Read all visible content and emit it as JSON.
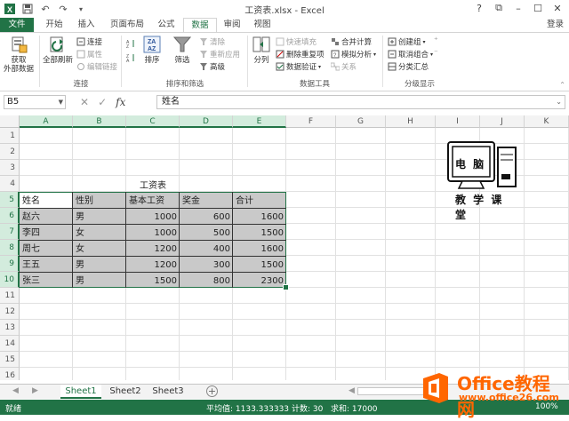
{
  "window": {
    "title": "工资表.xlsx - Excel",
    "controls": [
      "?",
      "⧉",
      "–",
      "☐",
      "✕"
    ]
  },
  "ribbon": {
    "tabs": [
      "文件",
      "开始",
      "插入",
      "页面布局",
      "公式",
      "数据",
      "审阅",
      "视图"
    ],
    "active_tab": "数据",
    "login": "登录",
    "groups": {
      "get_external": {
        "label": "获取\n外部数据",
        "line1": "获取",
        "line2": "外部数据"
      },
      "connections": {
        "label": "连接",
        "refresh_line1": "全部刷新",
        "items": [
          "连接",
          "属性",
          "编辑链接"
        ]
      },
      "sort_filter": {
        "label": "排序和筛选",
        "sort": "排序",
        "filter": "筛选",
        "items": [
          "清除",
          "重新应用",
          "高级"
        ]
      },
      "data_tools": {
        "label": "数据工具",
        "split": "分列",
        "items": [
          "快速填充",
          "删除重复项",
          "数据验证",
          "合并计算",
          "模拟分析",
          "关系"
        ]
      },
      "outline": {
        "label": "分级显示",
        "items": [
          "创建组",
          "取消组合",
          "分类汇总"
        ]
      }
    }
  },
  "formula_bar": {
    "name_box": "B5",
    "content": "姓名"
  },
  "grid": {
    "columns": [
      "A",
      "B",
      "C",
      "D",
      "E",
      "F",
      "G",
      "H",
      "I",
      "J",
      "K"
    ],
    "rows": [
      "1",
      "2",
      "3",
      "4",
      "5",
      "6",
      "7",
      "8",
      "9",
      "10",
      "11",
      "12",
      "13",
      "14",
      "15",
      "16"
    ],
    "table_title": "工资表",
    "headers": [
      "姓名",
      "性别",
      "基本工资",
      "奖金",
      "合计"
    ],
    "data": [
      [
        "赵六",
        "男",
        "1000",
        "600",
        "1600"
      ],
      [
        "李四",
        "女",
        "1000",
        "500",
        "1500"
      ],
      [
        "周七",
        "女",
        "1200",
        "400",
        "1600"
      ],
      [
        "王五",
        "男",
        "1200",
        "300",
        "1500"
      ],
      [
        "张三",
        "男",
        "1500",
        "800",
        "2300"
      ]
    ]
  },
  "logo": {
    "line1": "电 脑",
    "line2": "教 学 课 堂"
  },
  "sheets": {
    "tabs": [
      "Sheet1",
      "Sheet2",
      "Sheet3"
    ],
    "active": "Sheet1",
    "add": "+"
  },
  "status": {
    "mode": "就绪",
    "average": "平均值: 1133.333333",
    "count": "计数: 30",
    "sum": "求和: 17000",
    "zoom": "100%"
  },
  "watermark": {
    "title": "Office教程网",
    "url": "www.office26.com"
  },
  "colors": {
    "excel_green": "#217346",
    "watermark_orange": "#ff6600",
    "range_fill": "#c9c9c9"
  }
}
